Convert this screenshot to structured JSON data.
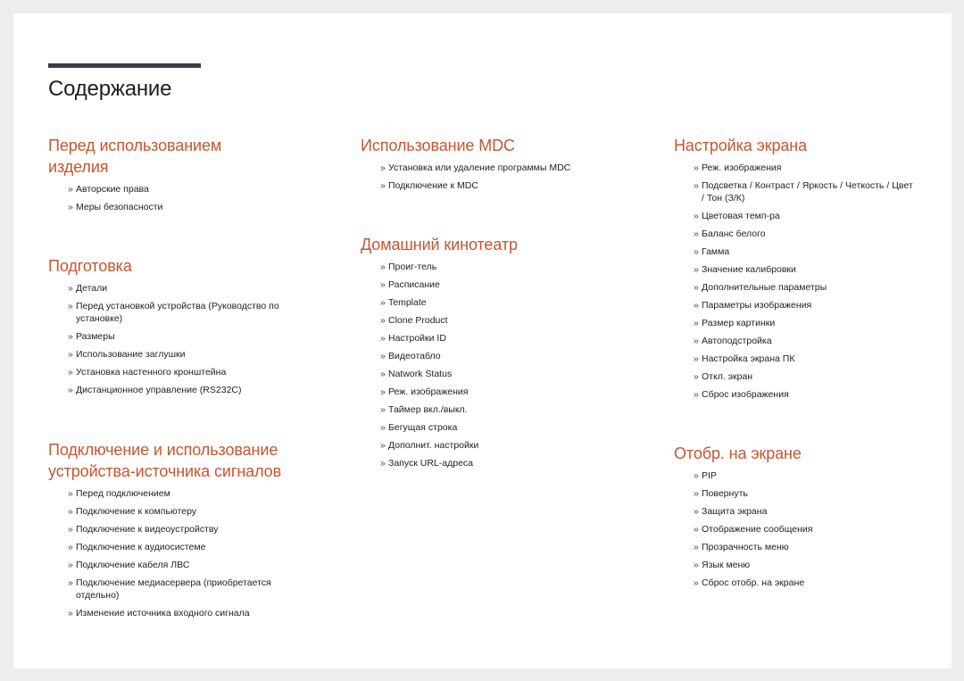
{
  "page": {
    "title": "Содержание",
    "bullet": "»",
    "colors": {
      "heading": "#c9552e",
      "title_bar": "#3d3d45",
      "text": "#222222",
      "background": "#ededed"
    }
  },
  "columns": [
    {
      "sections": [
        {
          "heading": "Перед использованием изделия",
          "items": [
            "Авторские права",
            "Меры безопасности"
          ]
        },
        {
          "heading": "Подготовка",
          "items": [
            "Детали",
            "Перед установкой устройства (Руководство по установке)",
            "Размеры",
            "Использование заглушки",
            "Установка настенного кронштейна",
            "Дистанционное управление (RS232C)"
          ]
        },
        {
          "heading": "Подключение и использование устройства-источника сигналов",
          "items": [
            "Перед подключением",
            "Подключение к компьютеру",
            "Подключение к видеоустройству",
            "Подключение к аудиосистеме",
            "Подключение кабеля ЛВС",
            "Подключение медиасервера (приобретается отдельно)",
            "Изменение источника входного сигнала"
          ]
        }
      ]
    },
    {
      "sections": [
        {
          "heading": "Использование MDC",
          "items": [
            "Установка или удаление программы MDC",
            "Подключение к MDC"
          ]
        },
        {
          "heading": "Домашний кинотеатр",
          "items": [
            "Проиг-тель",
            "Расписание",
            "Template",
            "Clone Product",
            "Настройки ID",
            "Видеотабло",
            "Natwork Status",
            "Реж. изображения",
            "Таймер вкл./выкл.",
            "Бегущая строка",
            "Дополнит. настройки",
            "Запуск URL-адреса"
          ]
        }
      ]
    },
    {
      "sections": [
        {
          "heading": "Настройка экрана",
          "items": [
            "Реж. изображения",
            "Подсветка / Контраст / Яркость / Четкость / Цвет / Тон (З/К)",
            "Цветовая темп-ра",
            "Баланс белого",
            "Гамма",
            "Значение калибровки",
            "Дополнительные параметры",
            "Параметры изображения",
            "Размер картинки",
            "Автоподстройка",
            "Настройка экрана ПК",
            "Откл. экран",
            "Сброс изображения"
          ]
        },
        {
          "heading": "Отобр. на экране",
          "items": [
            "PIP",
            "Повернуть",
            "Защита экрана",
            "Отображение сообщения",
            "Прозрачность меню",
            "Язык меню",
            "Сброс отобр. на экране"
          ]
        }
      ]
    }
  ]
}
